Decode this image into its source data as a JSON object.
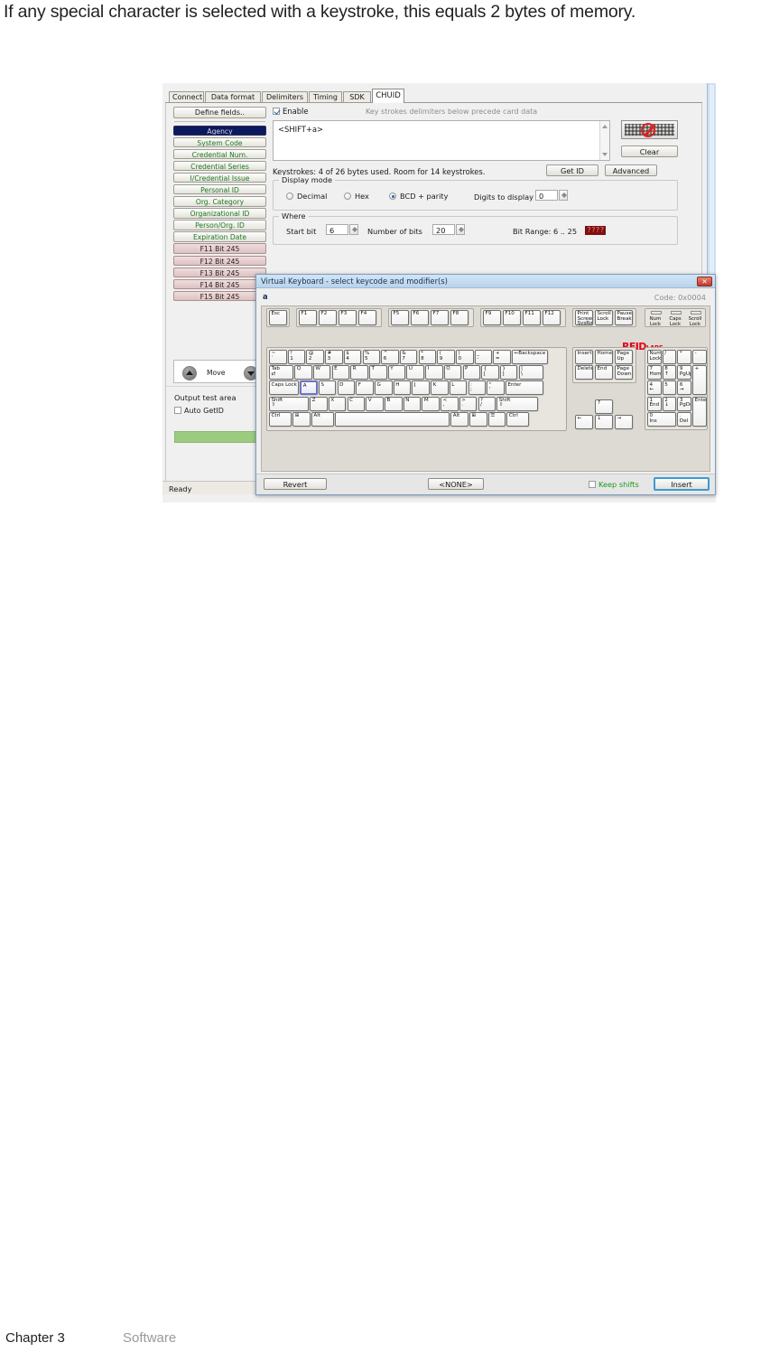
{
  "page": {
    "sentence": "If any special character is selected with a keystroke, this equals 2 bytes of memory.",
    "footer_chapter": "Chapter 3",
    "footer_section": "Software"
  },
  "app": {
    "tabs": [
      {
        "label": "Connect",
        "active": false
      },
      {
        "label": "Data format",
        "active": false
      },
      {
        "label": "Delimiters",
        "active": false
      },
      {
        "label": "Timing",
        "active": false
      },
      {
        "label": "SDK",
        "active": false
      },
      {
        "label": "CHUID",
        "active": true
      }
    ],
    "status_bar": "Ready",
    "field_list": {
      "define_fields_label": "Define fields..",
      "items": [
        {
          "label": "Agency",
          "style": "selected"
        },
        {
          "label": "System Code",
          "style": "green"
        },
        {
          "label": "Credential Num.",
          "style": "green"
        },
        {
          "label": "Credential Series",
          "style": "green"
        },
        {
          "label": "I/Credential Issue",
          "style": "green"
        },
        {
          "label": "Personal ID",
          "style": "green"
        },
        {
          "label": "Org. Category",
          "style": "green"
        },
        {
          "label": "Organizational ID",
          "style": "green"
        },
        {
          "label": "Person/Org. ID",
          "style": "green"
        },
        {
          "label": "Expiration Date",
          "style": "green"
        },
        {
          "label": "F11 Bit 245",
          "style": "pink"
        },
        {
          "label": "F12 Bit 245",
          "style": "pink"
        },
        {
          "label": "F13 Bit 245",
          "style": "pink"
        },
        {
          "label": "F14 Bit 245",
          "style": "pink"
        },
        {
          "label": "F15 Bit 245",
          "style": "pink"
        }
      ],
      "move_label": "Move"
    },
    "output_test": {
      "title": "Output test area",
      "auto_getid_label": "Auto GetID",
      "auto_getid_checked": false,
      "result_value": ""
    },
    "chuid": {
      "enable_label": "Enable",
      "enable_checked": true,
      "hint": "Key strokes delimiters below precede card data",
      "keystroke_text": "<SHIFT+a>",
      "clear_label": "Clear",
      "keystrokes_status": "Keystrokes: 4 of 26 bytes used. Room for 14 keystrokes.",
      "get_id_label": "Get ID",
      "advanced_label": "Advanced",
      "display_mode": {
        "caption": "Display mode",
        "options": [
          {
            "label": "Decimal",
            "selected": false
          },
          {
            "label": "Hex",
            "selected": false
          },
          {
            "label": "BCD + parity",
            "selected": true
          }
        ],
        "digits_label": "Digits to display",
        "digits_value": "0"
      },
      "where": {
        "caption": "Where",
        "start_bit_label": "Start bit",
        "start_bit_value": "6",
        "number_of_bits_label": "Number of bits",
        "number_of_bits_value": "20",
        "bit_range_label": "Bit Range: 6 .. 25",
        "bit_range_badge": "????"
      }
    }
  },
  "virtual_keyboard": {
    "title": "Virtual Keyboard - select keycode and modifier(s)",
    "close_glyph": "✕",
    "selected_char": "a",
    "code_label": "Code: 0x0004",
    "brand": "RFID",
    "brand_suffix": "LABS",
    "leds": [
      {
        "label": "Num\nLock"
      },
      {
        "label": "Caps\nLock"
      },
      {
        "label": "Scroll\nLock"
      }
    ],
    "selected_key": "A",
    "rows": {
      "function": [
        "Esc",
        "F1",
        "F2",
        "F3",
        "F4",
        "F5",
        "F6",
        "F7",
        "F8",
        "F9",
        "F10",
        "F11",
        "F12"
      ],
      "sysblock": [
        "Print\nScreen\nSysRq",
        "Scroll\nLock",
        "Pause\nBreak"
      ],
      "number": [
        "~\n`",
        "!\n1",
        "@\n2",
        "#\n3",
        "$\n4",
        "%\n5",
        "^\n6",
        "&\n7",
        "*\n8",
        "(\n9",
        ")\n0",
        "_\n-",
        "+\n=",
        "←Backspace"
      ],
      "tab": [
        "Tab\n⇄",
        "Q",
        "W",
        "E",
        "R",
        "T",
        "Y",
        "U",
        "I",
        "O",
        "P",
        "{\n[",
        "}\n]",
        "|\n\\"
      ],
      "caps": [
        "Caps Lock",
        "A",
        "S",
        "D",
        "F",
        "G",
        "H",
        "J",
        "K",
        "L",
        ":\n;",
        "\"\n'",
        "Enter"
      ],
      "shift": [
        "Shift\n⇧",
        "Z",
        "X",
        "C",
        "V",
        "B",
        "N",
        "M",
        "<\n,",
        ">\n.",
        "?\n/",
        "Shift\n⇧"
      ],
      "ctrl": [
        "Ctrl",
        "⊞",
        "Alt",
        "",
        "Alt",
        "⊞",
        "☰",
        "Ctrl"
      ],
      "nav6": [
        "Insert",
        "Home",
        "Page\nUp",
        "Delete",
        "End",
        "Page\nDown"
      ],
      "arrows": [
        "↑",
        "←",
        "↓",
        "→"
      ],
      "numpad": [
        "Num\nLock",
        "/",
        "*",
        "-",
        "7\nHome",
        "8\n↑",
        "9\nPgUp",
        "+",
        "4\n←",
        "5",
        "6\n→",
        "1\nEnd",
        "2\n↓",
        "3\nPgDn",
        "Enter",
        "0\nIns",
        ".\nDel"
      ]
    },
    "footer": {
      "revert_label": "Revert",
      "none_label": "<NONE>",
      "keep_shifts_label": "Keep shifts",
      "keep_shifts_checked": false,
      "insert_label": "Insert"
    }
  }
}
